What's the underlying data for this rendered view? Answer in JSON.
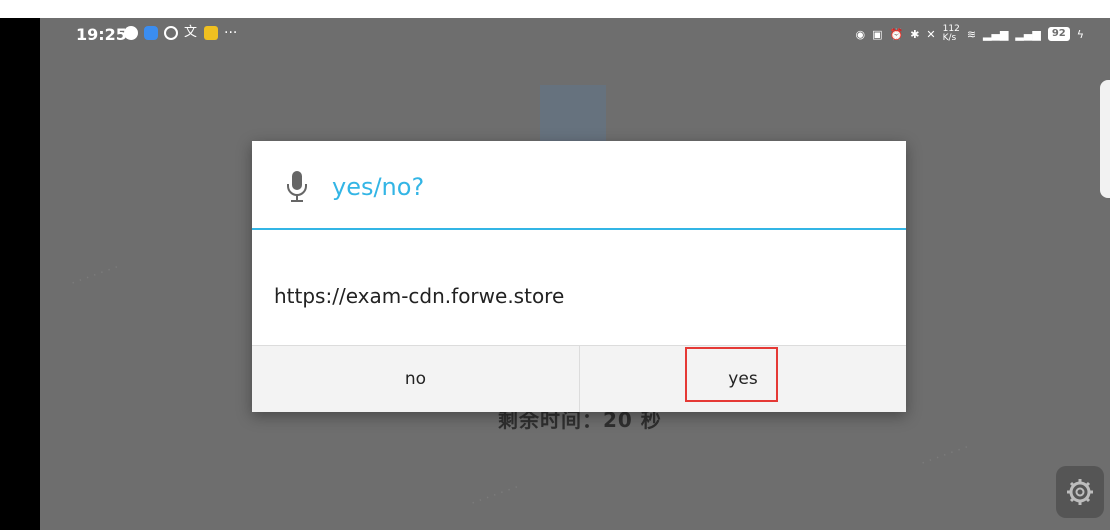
{
  "status_bar": {
    "time": "19:25",
    "more": "···",
    "net_speed_top": "112",
    "net_speed_unit": "K/s",
    "battery": "92"
  },
  "background": {
    "timer_text": "剩余时间：20 秒"
  },
  "dialog": {
    "icon": "microphone-icon",
    "title": "yes/no?",
    "message": "https://exam-cdn.forwe.store",
    "no_label": "no",
    "yes_label": "yes",
    "accent_color": "#33b5e5",
    "highlight_color": "#e53935"
  }
}
